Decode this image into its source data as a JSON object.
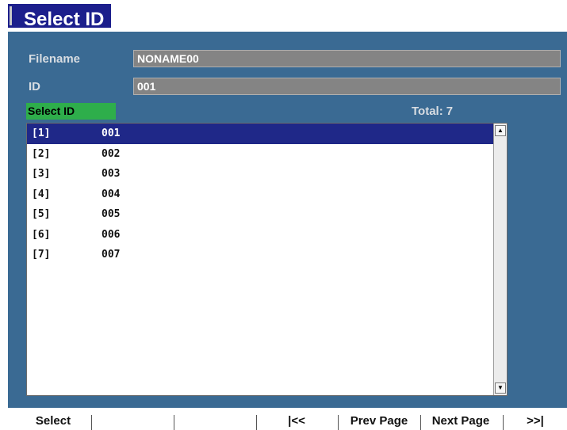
{
  "window": {
    "title": "Select ID"
  },
  "form": {
    "filename_label": "Filename",
    "filename_value": "NONAME00",
    "id_label": "ID",
    "id_value": "001"
  },
  "list_header": {
    "select_label": "Select ID",
    "total_label": "Total:",
    "total_value": "7"
  },
  "list": {
    "selected_index": 0,
    "items": [
      {
        "index": "[1]",
        "id": "001"
      },
      {
        "index": "[2]",
        "id": "002"
      },
      {
        "index": "[3]",
        "id": "003"
      },
      {
        "index": "[4]",
        "id": "004"
      },
      {
        "index": "[5]",
        "id": "005"
      },
      {
        "index": "[6]",
        "id": "006"
      },
      {
        "index": "[7]",
        "id": "007"
      }
    ]
  },
  "softkeys": {
    "select": "Select",
    "first": "|<<",
    "prev_page": "Prev Page",
    "next_page": "Next Page",
    "last": ">>|"
  },
  "colors": {
    "title_bg": "#1c1f8c",
    "panel_bg": "#3a6a93",
    "selection_bg": "#1f2888",
    "tag_green": "#2eae4b",
    "field_bg": "#848484"
  },
  "icons": {
    "scroll_up": "scroll-up-arrow-icon",
    "scroll_down": "scroll-down-arrow-icon"
  }
}
